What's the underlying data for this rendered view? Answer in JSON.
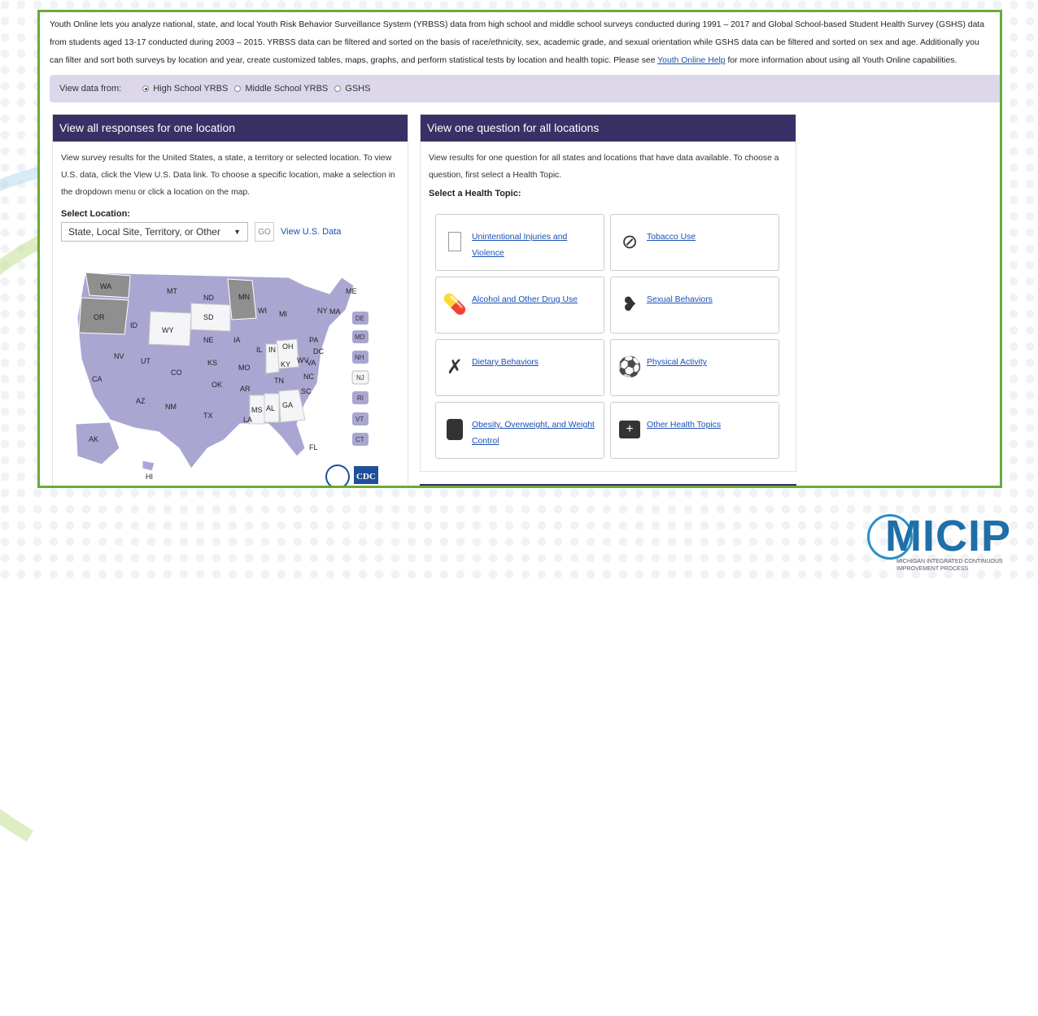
{
  "intro": {
    "text_before": "Youth Online lets you analyze national, state, and local Youth Risk Behavior Surveillance System (YRBSS) data from high school and middle school surveys conducted during 1991 – 2017 and Global School-based Student Health Survey (GSHS) data from students aged 13-17 conducted during 2003 – 2015. YRBSS data can be filtered and sorted on the basis of race/ethnicity, sex, academic grade, and sexual orientation while GSHS data can be filtered and sorted on sex and age. Additionally you can filter and sort both surveys by location and year, create customized tables, maps, graphs, and perform statistical tests by location and health topic. Please see ",
    "link": "Youth Online Help",
    "text_after": " for more information about using all Youth Online capabilities."
  },
  "view_data": {
    "label": "View data from:",
    "options": [
      "High School YRBS",
      "Middle School YRBS",
      "GSHS"
    ],
    "selected": "High School YRBS"
  },
  "left_panel": {
    "title": "View all responses for one location",
    "description": "View survey results for the United States, a state, a territory or selected location. To view U.S. data, click the View U.S. Data link. To choose a specific location, make a selection in the dropdown menu or click a location on the map.",
    "select_label": "Select Location:",
    "select_value": "State, Local Site, Territory, or Other",
    "go_label": "GO",
    "view_us_label": "View U.S. Data",
    "map_states": [
      "WA",
      "OR",
      "MT",
      "ID",
      "WY",
      "NV",
      "UT",
      "CA",
      "AZ",
      "NM",
      "CO",
      "ND",
      "SD",
      "NE",
      "KS",
      "OK",
      "TX",
      "MN",
      "IA",
      "MO",
      "AR",
      "LA",
      "WI",
      "MI",
      "IL",
      "IN",
      "OH",
      "KY",
      "TN",
      "MS",
      "AL",
      "GA",
      "SC",
      "NC",
      "VA",
      "WV",
      "PA",
      "NY",
      "ME",
      "MA",
      "DC",
      "FL",
      "AK",
      "HI"
    ],
    "small_states": [
      "DE",
      "MD",
      "NH",
      "NJ",
      "RI",
      "VT",
      "CT"
    ],
    "cdc_label": "CDC"
  },
  "right_panel": {
    "title": "View one question for all locations",
    "description": "View results for one question for all states and locations that have data available. To choose a question, first select a Health Topic.",
    "topic_label": "Select a Health Topic:",
    "topics": [
      {
        "label": "Unintentional Injuries and Violence",
        "icon": "square-icon"
      },
      {
        "label": "Tobacco Use",
        "icon": "no-smoking-icon"
      },
      {
        "label": "Alcohol and Other Drug Use",
        "icon": "pills-icon"
      },
      {
        "label": "Sexual Behaviors",
        "icon": "hearts-icon"
      },
      {
        "label": "Dietary Behaviors",
        "icon": "utensils-icon"
      },
      {
        "label": "Physical Activity",
        "icon": "bike-ball-icon"
      },
      {
        "label": "Obesity, Overweight, and Weight Control",
        "icon": "scale-icon"
      },
      {
        "label": "Other Health Topics",
        "icon": "first-aid-kit-icon"
      }
    ]
  },
  "logo": {
    "name": "MICIP",
    "subtitle": "MICHIGAN INTEGRATED CONTINUOUS IMPROVEMENT PROCESS"
  }
}
